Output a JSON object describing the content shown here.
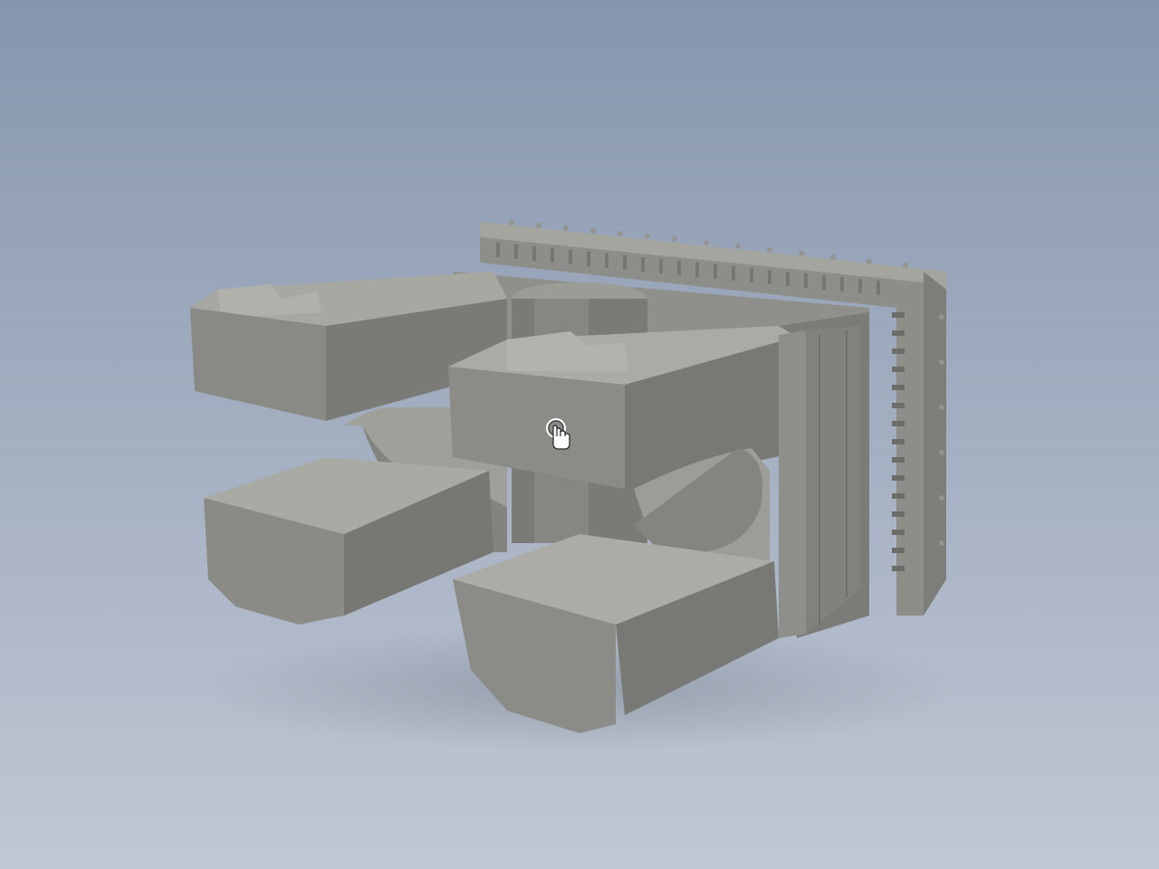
{
  "viewport": {
    "background_top": "#8796ad",
    "background_bottom": "#c1c7d3"
  },
  "model": {
    "description_icon": "cad-part-3d-model",
    "color_top": "#a9aaa4",
    "color_front": "#8a8b86",
    "color_side": "#757671",
    "color_dark": "#64655f"
  },
  "cursor": {
    "icon": "orbit-hand-cursor-icon"
  }
}
